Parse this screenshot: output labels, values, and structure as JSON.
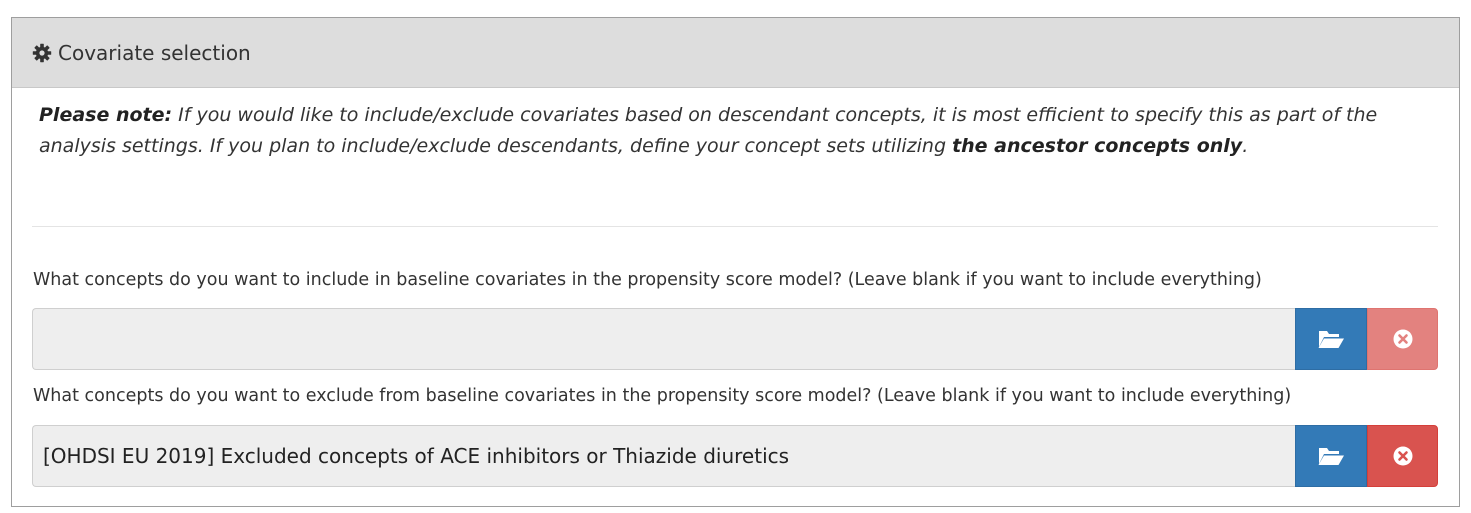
{
  "panel": {
    "title": "Covariate selection",
    "icon": "cog-icon"
  },
  "note": {
    "lead": "Please note:",
    "text": " If you would like to include/exclude covariates based on descendant concepts, it is most efficient to specify this as part of the analysis settings. If you plan to include/exclude descendants, define your concept sets utilizing ",
    "emphasis": "the ancestor concepts only",
    "tail": "."
  },
  "include": {
    "label": "What concepts do you want to include in baseline covariates in the propensity score model? (Leave blank if you want to include everything)",
    "value": "",
    "open_icon": "folder-open-icon",
    "clear_icon": "times-circle-icon",
    "clear_disabled": true
  },
  "exclude": {
    "label": "What concepts do you want to exclude from baseline covariates in the propensity score model? (Leave blank if you want to include everything)",
    "value": "[OHDSI EU 2019] Excluded concepts of ACE inhibitors or Thiazide diuretics",
    "open_icon": "folder-open-icon",
    "clear_icon": "times-circle-icon",
    "clear_disabled": false
  },
  "colors": {
    "primary": "#337ab7",
    "danger": "#d9534f",
    "heading_bg": "#dddddd",
    "input_bg": "#eeeeee"
  }
}
